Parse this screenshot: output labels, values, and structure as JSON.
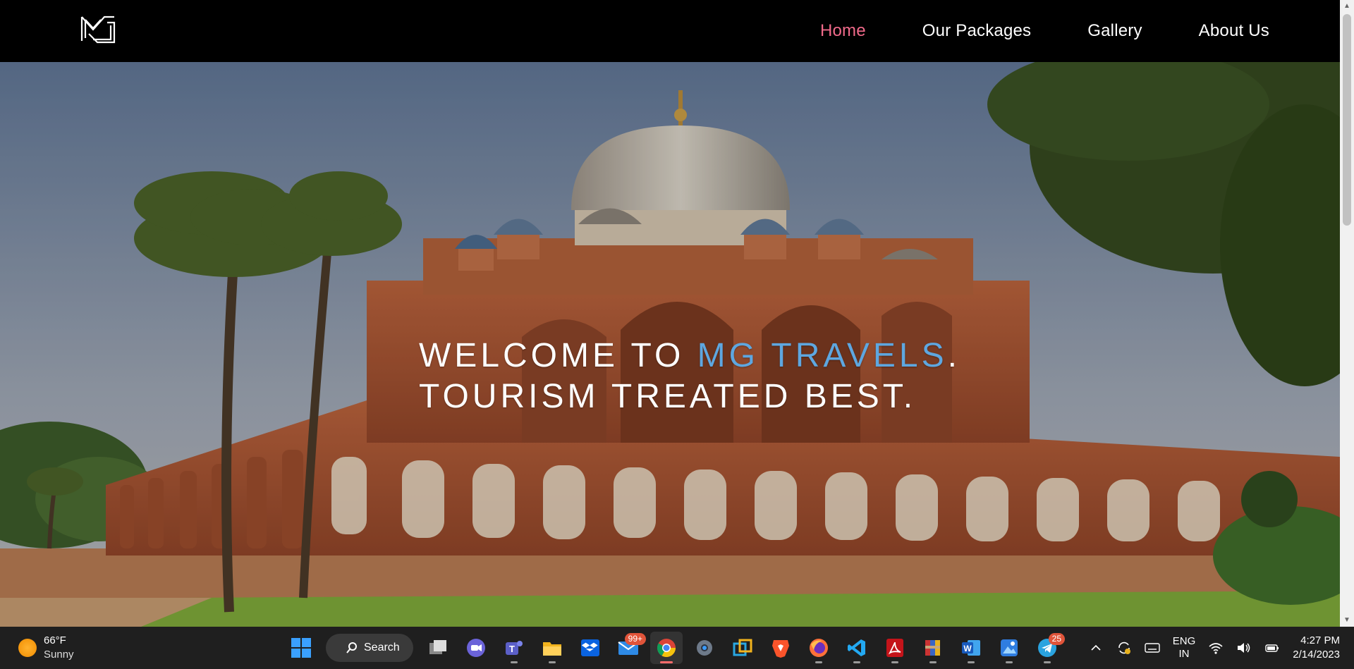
{
  "nav": {
    "items": [
      {
        "label": "Home",
        "active": true
      },
      {
        "label": "Our Packages",
        "active": false
      },
      {
        "label": "Gallery",
        "active": false
      },
      {
        "label": "About Us",
        "active": false
      }
    ],
    "active_color": "#f06a8a"
  },
  "hero": {
    "line1_prefix": "WELCOME TO ",
    "line1_brand": "MG TRAVELS",
    "line1_suffix": ".",
    "line2": "TOURISM TREATED BEST.",
    "brand_color": "#5ea7e0"
  },
  "taskbar": {
    "weather": {
      "temp": "66°F",
      "condition": "Sunny"
    },
    "search_label": "Search",
    "mail_badge": "99+",
    "telegram_badge": "25",
    "language": {
      "line1": "ENG",
      "line2": "IN"
    },
    "clock": {
      "time": "4:27 PM",
      "date": "2/14/2023"
    }
  }
}
